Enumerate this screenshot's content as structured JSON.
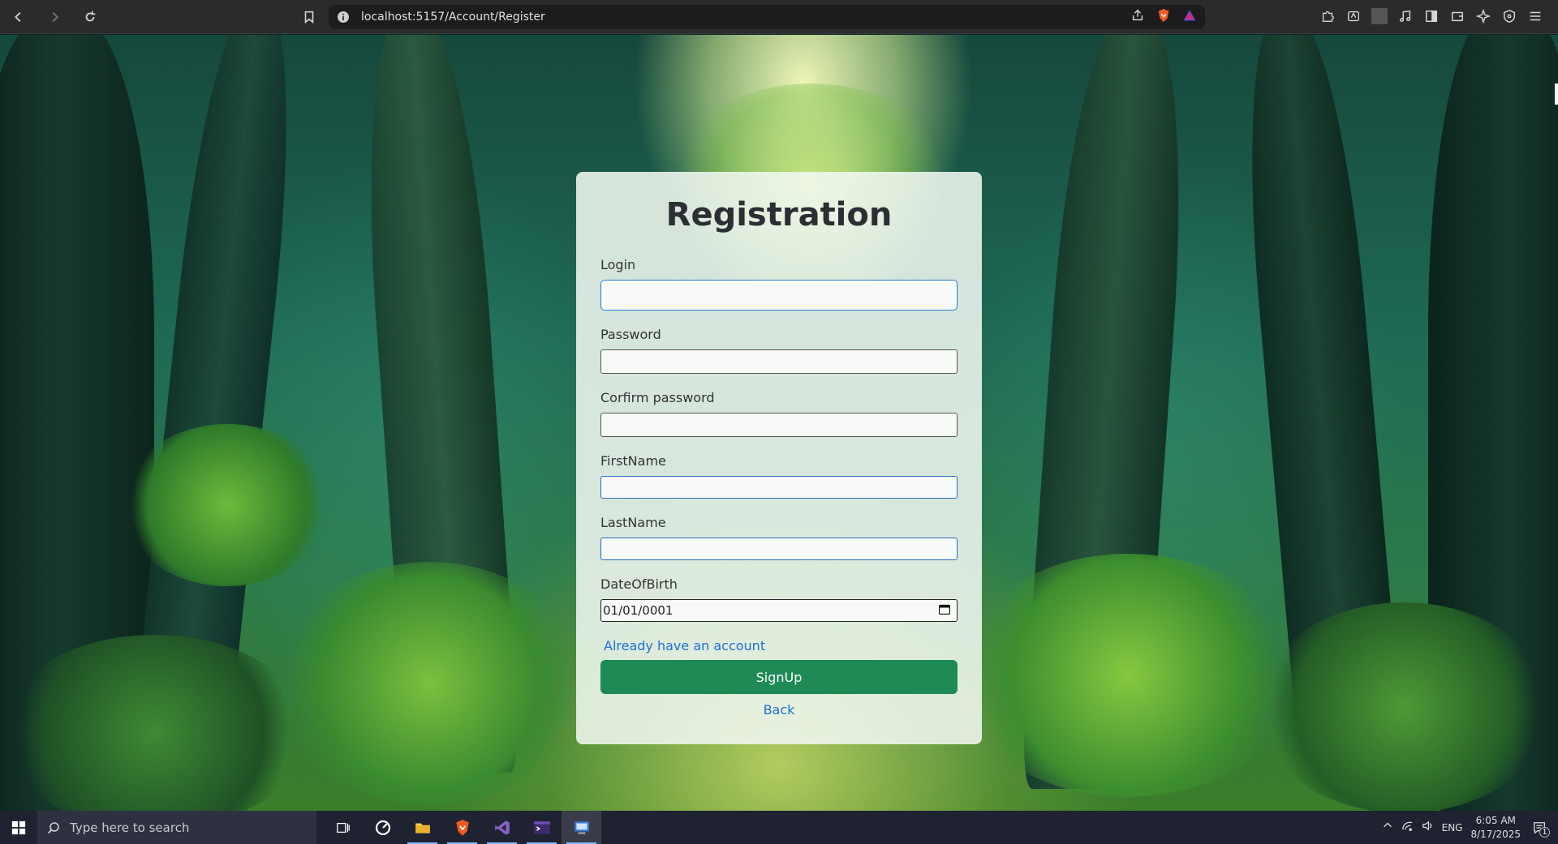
{
  "browser": {
    "url": "localhost:5157/Account/Register"
  },
  "page": {
    "title": "Registration",
    "fields": {
      "login_label": "Login",
      "password_label": "Password",
      "confirm_password_label": "Corfirm password",
      "firstname_label": "FirstName",
      "lastname_label": "LastName",
      "dob_label": "DateOfBirth",
      "dob_value": "01/01/0001"
    },
    "already_account_link": "Already have an account",
    "signup_button": "SignUp",
    "back_link": "Back"
  },
  "taskbar": {
    "search_placeholder": "Type here to search",
    "apps": [
      "task-view-icon",
      "app-circle-icon",
      "file-explorer-icon",
      "brave-browser-icon",
      "visual-studio-icon",
      "terminal-icon",
      "remote-desktop-icon"
    ],
    "language": "ENG",
    "time": "6:05 AM",
    "date": "8/17/2025",
    "notification_count": "1"
  },
  "colors": {
    "accent_button": "#1e8a55",
    "link": "#1f6fd1",
    "focus_border": "#2b7cd3"
  }
}
